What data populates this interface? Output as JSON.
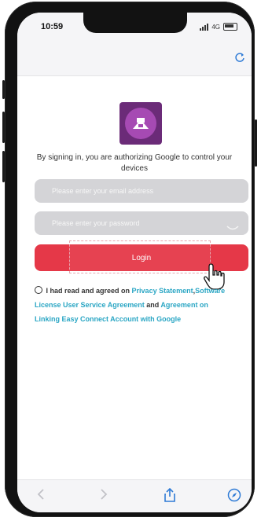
{
  "status": {
    "time": "10:59",
    "network": "4G"
  },
  "header": {
    "refresh_icon": "refresh-icon"
  },
  "logo": {
    "icon": "app-logo"
  },
  "description": "By signing in, you are authorizing Google to control your devices",
  "email": {
    "placeholder": "Please enter your email address",
    "value": ""
  },
  "password": {
    "placeholder": "Please enter your password",
    "value": ""
  },
  "login": {
    "label": "Login"
  },
  "agreement": {
    "prefix": "I had read and agreed on ",
    "privacy": "Privacy Statement",
    "sep": ",",
    "license": "Software License User Service Agreement",
    "and": " and ",
    "linking": "Agreement on Linking Easy Connect Account with Google"
  },
  "toolbar": {
    "back": "back-icon",
    "forward": "forward-icon",
    "share": "share-icon",
    "compass": "compass-icon"
  },
  "colors": {
    "accent": "#e53848",
    "link": "#2aa6c4",
    "logo": "#6b2b78"
  }
}
